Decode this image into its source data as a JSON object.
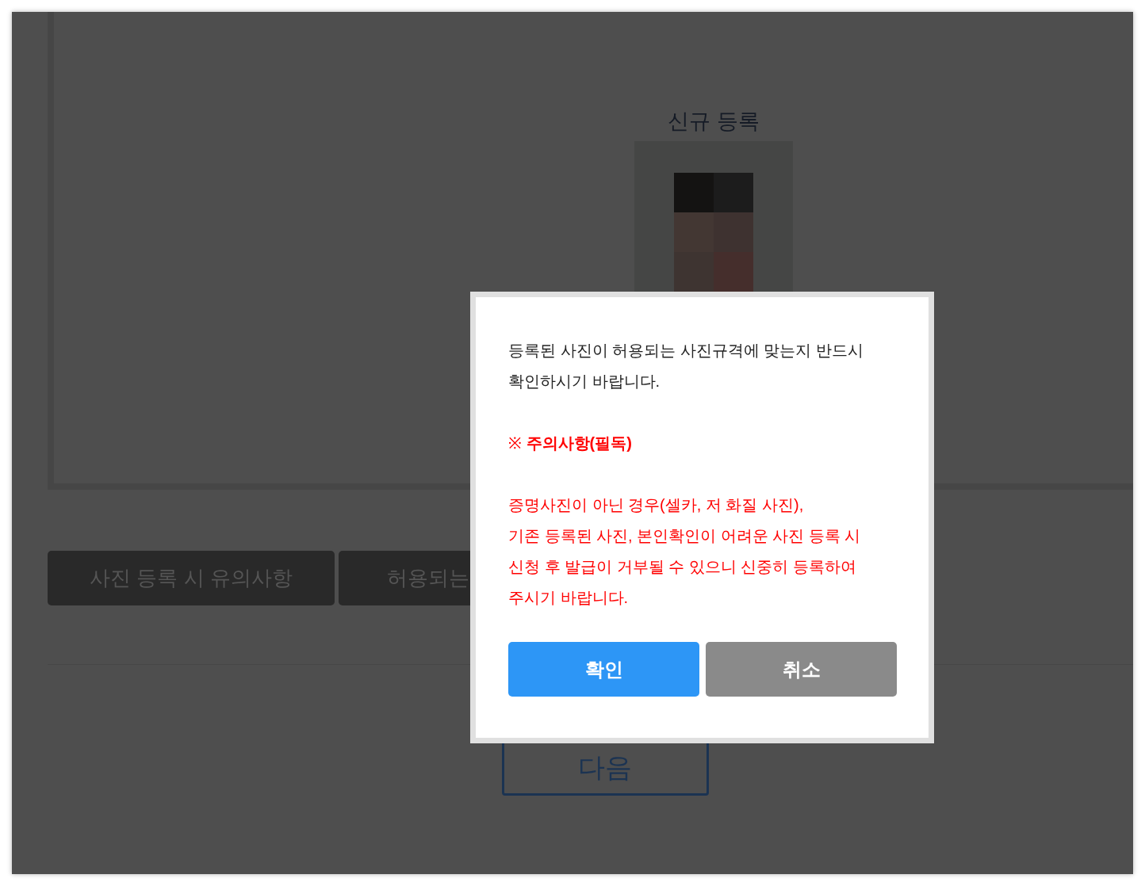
{
  "page": {
    "title": "신규 등록",
    "tabs": [
      {
        "label": "사진 등록 시 유의사항"
      },
      {
        "label": "허용되는"
      }
    ],
    "next_button": "다음"
  },
  "dialog": {
    "message_lines": [
      "등록된 사진이 허용되는 사진규격에 맞는지 반드시",
      "확인하시기 바랍니다."
    ],
    "notice_mark": "※",
    "notice_title": "주의사항(필독)",
    "warning_lines": [
      "증명사진이 아닌 경우(셀카, 저 화질 사진),",
      "기존 등록된 사진, 본인확인이 어려운 사진 등록 시",
      "신청 후 발급이 거부될 수 있으니 신중히 등록하여",
      "주시기 바랍니다."
    ],
    "buttons": [
      {
        "label": "확인",
        "kind": "primary"
      },
      {
        "label": "취소",
        "kind": "secondary"
      }
    ]
  }
}
